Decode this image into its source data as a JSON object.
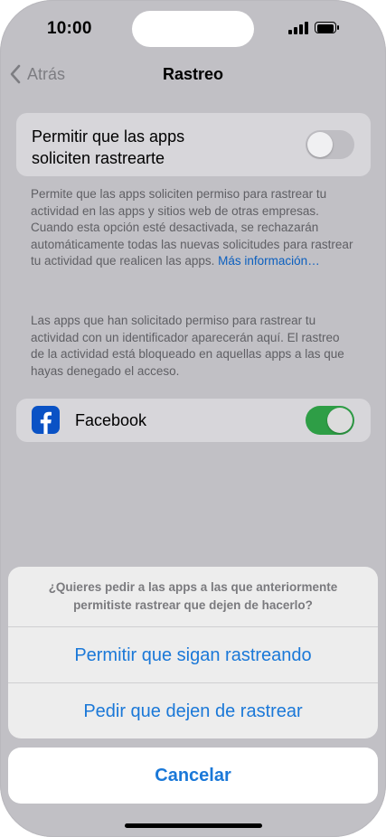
{
  "status_bar": {
    "time": "10:00"
  },
  "nav": {
    "back_label": "Atrás",
    "title": "Rastreo"
  },
  "permit": {
    "label_line1": "Permitir que las apps",
    "label_line2": "soliciten rastrearte",
    "toggle_on": false
  },
  "footer1": {
    "text": "Permite que las apps soliciten permiso para rastrear tu actividad en las apps y sitios web de otras empresas. Cuando esta opción esté desactivada, se rechazarán automáticamente todas las nuevas solicitudes para rastrear tu actividad que realicen las apps.",
    "link": "Más información…"
  },
  "footer2": {
    "text": "Las apps que han solicitado permiso para rastrear tu actividad con un identificador aparecerán aquí. El rastreo de la actividad está bloqueado en aquellas apps a las que hayas denegado el acceso."
  },
  "apps": [
    {
      "name": "Facebook",
      "icon": "facebook-icon",
      "toggle_on": true
    }
  ],
  "action_sheet": {
    "message": "¿Quieres pedir a las apps a las que anteriormente permitiste rastrear que dejen de hacerlo?",
    "option1": "Permitir que sigan rastreando",
    "option2": "Pedir que dejen de rastrear",
    "cancel": "Cancelar"
  },
  "colors": {
    "accent": "#1a78d8",
    "toggle_on": "#2e9e46",
    "facebook": "#0a52c5"
  }
}
